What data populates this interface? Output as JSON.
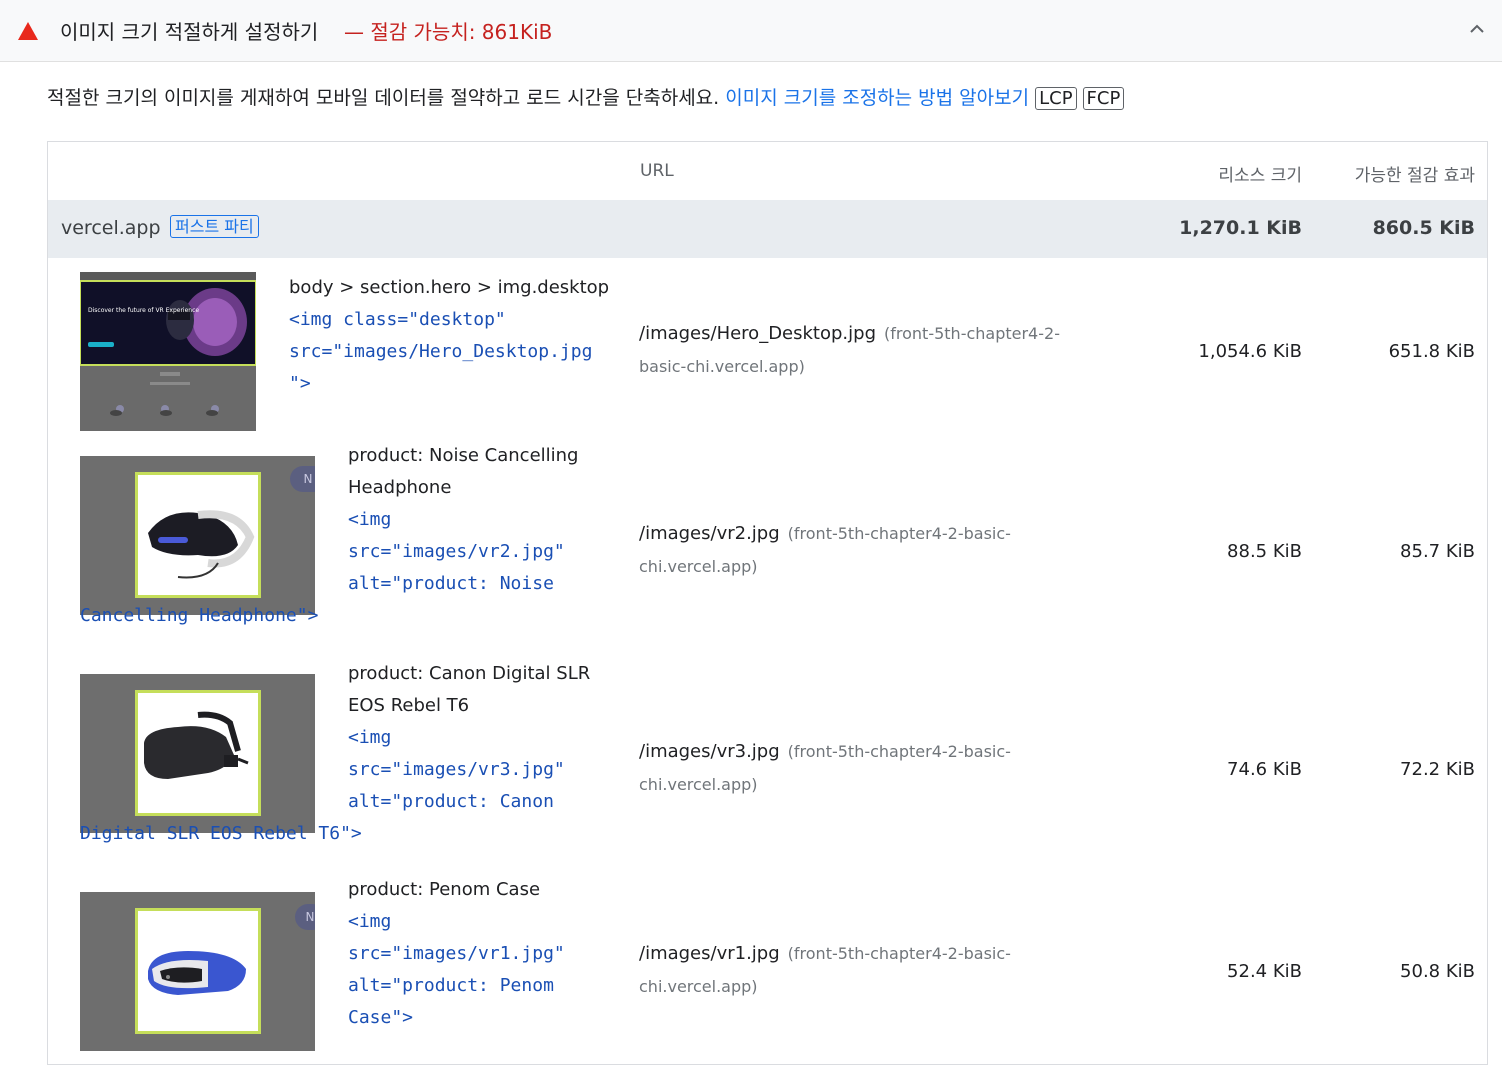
{
  "header": {
    "title": "이미지 크기 적절하게 설정하기",
    "savings": "— 절감 가능치: 861KiB"
  },
  "description": {
    "text": "적절한 크기의 이미지를 게재하여 모바일 데이터를 절약하고 로드 시간을 단축하세요. ",
    "link": "이미지 크기를 조정하는 방법 알아보기",
    "tags": [
      "LCP",
      "FCP"
    ]
  },
  "table": {
    "columns": {
      "url": "URL",
      "size": "리소스 크기",
      "savings": "가능한 절감 효과"
    },
    "group": {
      "name": "vercel.app",
      "badge": "퍼스트 파티",
      "size": "1,270.1 KiB",
      "savings": "860.5 KiB"
    },
    "rows": [
      {
        "label": "body > section.hero > img.desktop",
        "code": "<img class=\"desktop\"\nsrc=\"images/Hero_Desktop.jpg\n\">",
        "path": "/images/Hero_Desktop.jpg",
        "host": "(front-5th-chapter4-2-basic-chi.vercel.app)",
        "size": "1,054.6 KiB",
        "savings": "651.8 KiB",
        "thumb_text": "Discover the future of VR Experience"
      },
      {
        "label": "product: Noise Cancelling Headphone",
        "code": "<img\nsrc=\"images/vr2.jpg\"\nalt=\"product: Noise",
        "code_tail": "Cancelling Headphone\">",
        "path": "/images/vr2.jpg",
        "host": "(front-5th-chapter4-2-basic-chi.vercel.app)",
        "size": "88.5 KiB",
        "savings": "85.7 KiB"
      },
      {
        "label": "product: Canon Digital SLR EOS Rebel T6",
        "code": "<img\nsrc=\"images/vr3.jpg\"\nalt=\"product: Canon",
        "code_tail": "Digital SLR EOS Rebel T6\">",
        "path": "/images/vr3.jpg",
        "host": "(front-5th-chapter4-2-basic-chi.vercel.app)",
        "size": "74.6 KiB",
        "savings": "72.2 KiB"
      },
      {
        "label": "product: Penom Case",
        "code": "<img\nsrc=\"images/vr1.jpg\"\nalt=\"product: Penom\nCase\">",
        "path": "/images/vr1.jpg",
        "host": "(front-5th-chapter4-2-basic-chi.vercel.app)",
        "size": "52.4 KiB",
        "savings": "50.8 KiB"
      }
    ]
  },
  "colors": {
    "warning": "#e8291c",
    "savings_text": "#c5221f",
    "link": "#1a73e8",
    "code": "#1a4fb4",
    "thumb_frame": "#c5de5a"
  },
  "icons": {
    "warning": "warning-triangle-icon",
    "collapse": "chevron-up-icon"
  }
}
